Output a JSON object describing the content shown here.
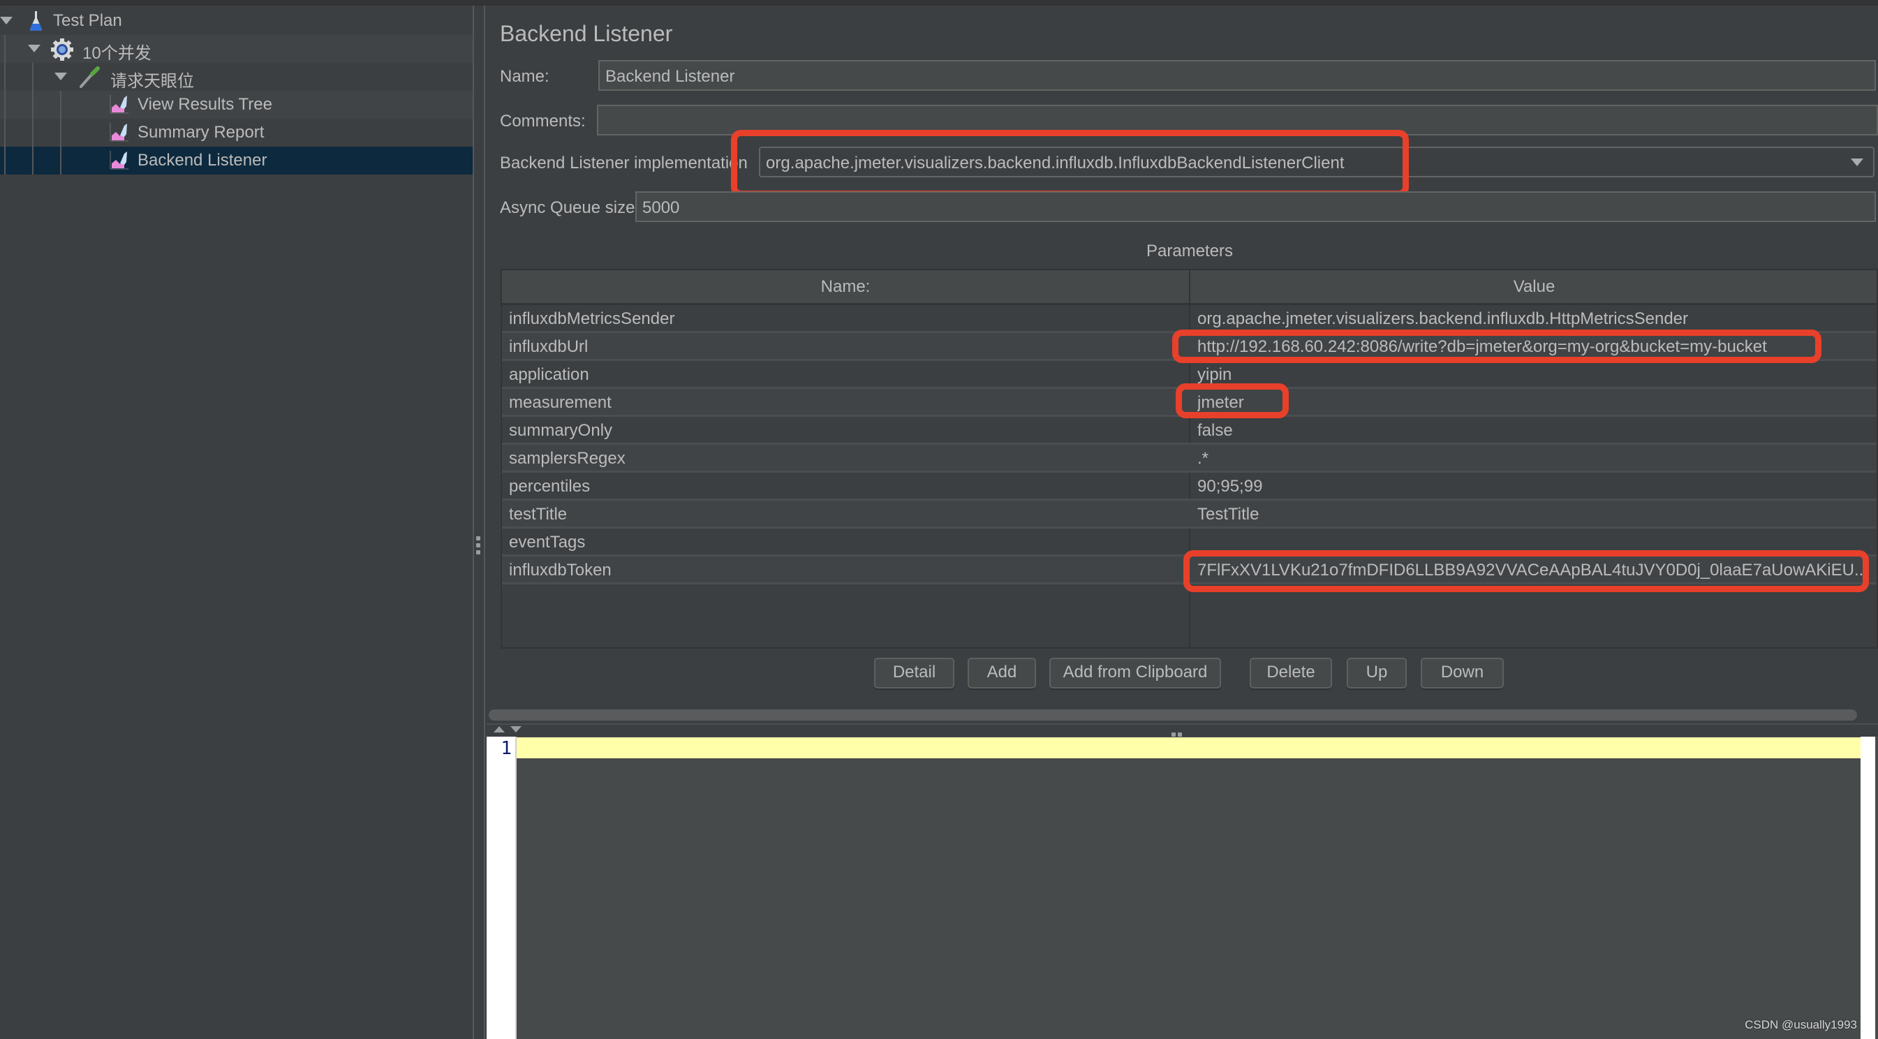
{
  "tree": {
    "items": [
      {
        "label": "Test Plan",
        "icon": "flask-icon",
        "expanded": true,
        "level": 0
      },
      {
        "label": "10个并发",
        "icon": "gear-icon",
        "expanded": true,
        "level": 1
      },
      {
        "label": "请求天眼位",
        "icon": "pipette-icon",
        "expanded": true,
        "level": 2
      },
      {
        "label": "View Results Tree",
        "icon": "listener-graph-icon",
        "level": 3
      },
      {
        "label": "Summary Report",
        "icon": "listener-graph-icon",
        "level": 3
      },
      {
        "label": "Backend Listener",
        "icon": "listener-graph-icon",
        "level": 3,
        "selected": true
      }
    ]
  },
  "main": {
    "title": "Backend Listener",
    "name_label": "Name:",
    "name_value": "Backend Listener",
    "comments_label": "Comments:",
    "comments_value": "",
    "implementation_label": "Backend Listener implementation",
    "implementation_value": "org.apache.jmeter.visualizers.backend.influxdb.InfluxdbBackendListenerClient",
    "queue_label": "Async Queue size",
    "queue_value": "5000",
    "parameters_label": "Parameters",
    "table": {
      "columns": [
        "Name:",
        "Value"
      ],
      "rows": [
        {
          "name": "influxdbMetricsSender",
          "value": "org.apache.jmeter.visualizers.backend.influxdb.HttpMetricsSender"
        },
        {
          "name": "influxdbUrl",
          "value": "http://192.168.60.242:8086/write?db=jmeter&org=my-org&bucket=my-bucket",
          "highlighted": true
        },
        {
          "name": "application",
          "value": "yipin"
        },
        {
          "name": "measurement",
          "value": "jmeter",
          "highlighted": true
        },
        {
          "name": "summaryOnly",
          "value": "false"
        },
        {
          "name": "samplersRegex",
          "value": ".*"
        },
        {
          "name": "percentiles",
          "value": "90;95;99"
        },
        {
          "name": "testTitle",
          "value": "TestTitle"
        },
        {
          "name": "eventTags",
          "value": ""
        },
        {
          "name": "influxdbToken",
          "value": "7FlFxXV1LVKu21o7fmDFID6LLBB9A92VVACeAApBAL4tuJVY0D0j_0laaE7aUowAKiEU...",
          "highlighted": true
        }
      ]
    },
    "buttons": {
      "detail": "Detail",
      "add": "Add",
      "add_from_clipboard": "Add from Clipboard",
      "delete": "Delete",
      "up": "Up",
      "down": "Down"
    }
  },
  "editor": {
    "line_number": "1",
    "content": ""
  },
  "annotation_color": "#e8402a",
  "selection_color": "#0d293e",
  "watermark": "CSDN @usually1993"
}
